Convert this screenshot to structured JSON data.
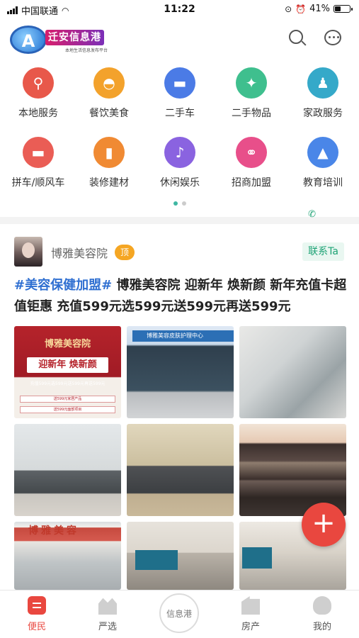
{
  "status_bar": {
    "carrier": "中国联通",
    "time": "11:22",
    "battery": "41%",
    "battery_level": 0.41
  },
  "header": {
    "logo_letter": "A",
    "logo_name": "迁安信息港",
    "logo_tagline": "本地生活信息发布平台",
    "icons": [
      "search-icon",
      "message-icon"
    ]
  },
  "categories": [
    {
      "label": "本地服务",
      "icon": "location-pin-icon",
      "glyph": "⚲",
      "color": "#e8584a"
    },
    {
      "label": "餐饮美食",
      "icon": "food-cloche-icon",
      "glyph": "◓",
      "color": "#f3a22c"
    },
    {
      "label": "二手车",
      "icon": "car-icon",
      "glyph": "▬",
      "color": "#4b7be6"
    },
    {
      "label": "二手物品",
      "icon": "shopping-bag-icon",
      "glyph": "✦",
      "color": "#3fbf8e"
    },
    {
      "label": "家政服务",
      "icon": "worker-icon",
      "glyph": "♟",
      "color": "#35a9c9"
    },
    {
      "label": "拼车/顺风车",
      "icon": "car-icon",
      "glyph": "▬",
      "color": "#ea5d55"
    },
    {
      "label": "装修建材",
      "icon": "paint-roller-icon",
      "glyph": "▮",
      "color": "#f08a33"
    },
    {
      "label": "休闲娱乐",
      "icon": "microphone-icon",
      "glyph": "♪",
      "color": "#8a63e0"
    },
    {
      "label": "招商加盟",
      "icon": "handshake-icon",
      "glyph": "⚭",
      "color": "#e84f8a"
    },
    {
      "label": "教育培训",
      "icon": "graduation-cap-icon",
      "glyph": "▲",
      "color": "#4a86e8"
    }
  ],
  "pager": {
    "pages": 2,
    "active": 0
  },
  "post": {
    "poster_name": "博雅美容院",
    "top_badge": "顶",
    "contact_label": "联系Ta",
    "hashtag": "#美容保健加盟#",
    "body": " 博雅美容院 迎新年 焕新颜 新年充值卡超值钜惠 充值599元选599元送599元再送599元",
    "photo1": {
      "title": "博雅美容院",
      "banner": "迎新年 焕新颜",
      "line": "充值599元选599元送599元再送599元",
      "item1": "送599元家居产品",
      "item2": "送599元面部项目"
    },
    "photo2_sign": "博雅美容皮肤护理中心",
    "photo7_sign": "博雅美容"
  },
  "fab": {
    "label": "+"
  },
  "tabbar": {
    "tabs": [
      {
        "label": "便民",
        "icon": "home-icon",
        "active": true
      },
      {
        "label": "严选",
        "icon": "shop-icon",
        "active": false
      },
      {
        "label": "房产",
        "icon": "building-icon",
        "active": false
      },
      {
        "label": "我的",
        "icon": "profile-icon",
        "active": false
      }
    ],
    "center_label": "信息港"
  }
}
